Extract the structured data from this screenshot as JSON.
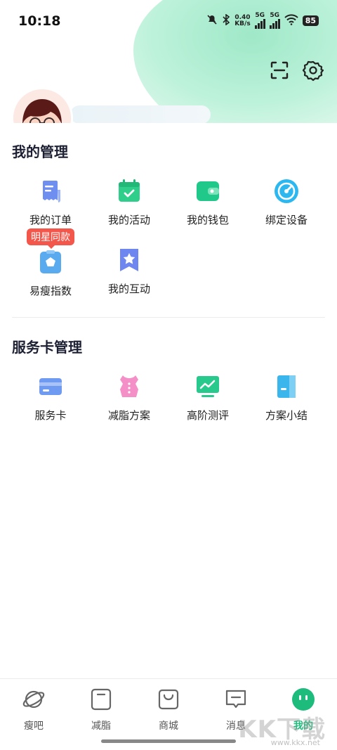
{
  "status_bar": {
    "time": "10:18",
    "net_speed_value": "0.40",
    "net_speed_unit": "KB/s",
    "sim1": "5G",
    "sim2": "5G",
    "battery": "85"
  },
  "header": {
    "scan_icon": "scan-icon",
    "settings_icon": "gear-icon"
  },
  "management": {
    "title": "我的管理",
    "items": [
      {
        "label": "我的订单",
        "icon": "order-icon",
        "color": "#6f8ff0"
      },
      {
        "label": "我的活动",
        "icon": "activity-icon",
        "color": "#2fcf8b"
      },
      {
        "label": "我的钱包",
        "icon": "wallet-icon",
        "color": "#20c98a"
      },
      {
        "label": "绑定设备",
        "icon": "device-icon",
        "color": "#2bb8f0"
      },
      {
        "label": "易瘦指数",
        "icon": "index-icon",
        "color": "#5aaaf0"
      },
      {
        "label": "我的互动",
        "icon": "interaction-icon",
        "color": "#6e86ef"
      }
    ],
    "badge": "明星同款"
  },
  "service_card": {
    "title": "服务卡管理",
    "items": [
      {
        "label": "服务卡",
        "icon": "card-icon",
        "color": "#6f9af2"
      },
      {
        "label": "减脂方案",
        "icon": "plan-icon",
        "color": "#f58fc8"
      },
      {
        "label": "高阶测评",
        "icon": "assessment-icon",
        "color": "#27c98d"
      },
      {
        "label": "方案小结",
        "icon": "summary-icon",
        "color": "#3bb6ec"
      }
    ]
  },
  "tabbar": {
    "tabs": [
      {
        "label": "瘦吧",
        "icon": "planet-icon"
      },
      {
        "label": "减脂",
        "icon": "fat-loss-icon"
      },
      {
        "label": "商城",
        "icon": "shop-bag-icon"
      },
      {
        "label": "消息",
        "icon": "message-icon"
      },
      {
        "label": "我的",
        "icon": "profile-face-icon",
        "active": true
      }
    ],
    "accent": "#1dbb7c"
  },
  "watermark": {
    "logo": "KK下载",
    "url": "www.kkx.net"
  }
}
